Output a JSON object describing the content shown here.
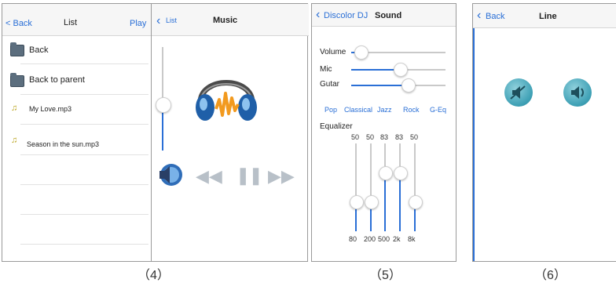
{
  "panel4": {
    "caption": "（4）",
    "list_nav": {
      "back": "< Back",
      "title": "List",
      "play": "Play"
    },
    "items": [
      {
        "label": "Back",
        "icon": "folder-icon"
      },
      {
        "label": "Back to parent",
        "icon": "folder-up-icon"
      },
      {
        "label": "My Love.mp3",
        "icon": "music-note-icon"
      },
      {
        "label": "Season in the sun.mp3",
        "icon": "music-note-icon"
      }
    ],
    "music_nav": {
      "back": "List",
      "title": "Music"
    },
    "volume_level": 0.6,
    "controls": [
      "speaker-icon",
      "rewind-icon",
      "pause-icon",
      "fast-forward-icon"
    ]
  },
  "panel5": {
    "caption": "（5）",
    "nav": {
      "back": "Discolor DJ",
      "title": "Sound"
    },
    "sliders": [
      {
        "label": "Volume",
        "value": 0.1
      },
      {
        "label": "Mic",
        "value": 0.52
      },
      {
        "label": "Gutar",
        "value": 0.6
      }
    ],
    "presets": [
      "Pop",
      "Classical",
      "Jazz",
      "Rock",
      "G-Eq"
    ],
    "equalizer_label": "Equalizer",
    "bands": [
      {
        "value": "50",
        "freq": "80",
        "level": 0.5
      },
      {
        "value": "50",
        "freq": "200",
        "level": 0.5
      },
      {
        "value": "83",
        "freq": "500",
        "level": 0.83
      },
      {
        "value": "83",
        "freq": "2k",
        "level": 0.83
      },
      {
        "value": "50",
        "freq": "8k",
        "level": 0.5
      }
    ]
  },
  "panel6": {
    "caption": "（6）",
    "nav": {
      "back": "Back",
      "title": "Line"
    },
    "buttons": [
      "mute-speaker-icon",
      "speaker-icon"
    ]
  },
  "colors": {
    "accent": "#2a6fd6",
    "teal": "#3c9fb4"
  }
}
